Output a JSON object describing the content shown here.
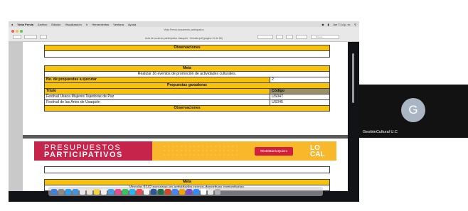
{
  "menubar": {
    "app_name": "Vista Previa",
    "items": [
      "Archivo",
      "Edición",
      "Visualización",
      "Ir",
      "Herramientas",
      "Ventana",
      "Ayuda"
    ],
    "clock": "Jue 7:14 p. m."
  },
  "window": {
    "title": "Vista Previa documento participativo",
    "subtitle": "Acta de acuerdo participativo Usaquén · firmada.pdf (página 11 de 56)",
    "search_placeholder": "Buscar"
  },
  "table_top": {
    "observaciones": "Observaciones"
  },
  "table_main": {
    "meta_header": "Meta",
    "meta_text": "Realizar 16 eventos de promoción de actividades culturales.",
    "proposals_label": "No. de propuestas a ejecutar",
    "proposals_count": "2",
    "winners_header": "Propuestas ganadoras",
    "col_title": "Título",
    "col_code": "Código",
    "rows": [
      {
        "title": "Festival Usaca Mujeres Tejedoras de Paz",
        "code": "US047"
      },
      {
        "title": "Festival de las Artes de Usaquén",
        "code": "US045"
      }
    ],
    "observaciones": "Observaciones"
  },
  "banner": {
    "line1": "PRESUPUESTOS",
    "line2": "PARTICIPATIVOS",
    "badge": "#EnMiBarrioQuiero",
    "local_1": "LO",
    "local_2": "CAL"
  },
  "table_bottom": {
    "meta_header": "Meta",
    "meta_text": "Vincular 9142 personas en actividades recreo-deportivas comunitarias."
  },
  "participant": {
    "initial": "G",
    "name": "GestiónCultural U.C"
  },
  "colors": {
    "header_yellow": "#f8c20a",
    "banner_red": "#c6244a",
    "banner_orange": "#f9b82b",
    "avatar": "#a9b5c2"
  }
}
